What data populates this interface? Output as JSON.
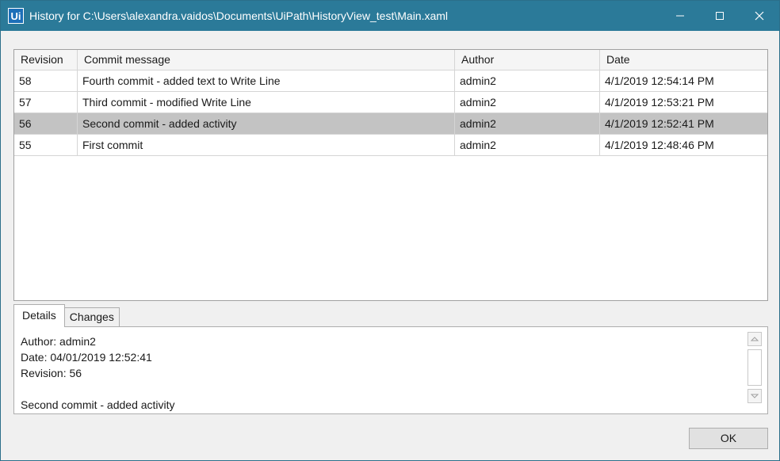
{
  "window": {
    "app_icon_label": "Ui",
    "title": "History for C:\\Users\\alexandra.vaidos\\Documents\\UiPath\\HistoryView_test\\Main.xaml"
  },
  "grid": {
    "headers": {
      "revision": "Revision",
      "message": "Commit message",
      "author": "Author",
      "date": "Date"
    },
    "rows": [
      {
        "revision": "58",
        "message": "Fourth commit - added text to Write Line",
        "author": "admin2",
        "date": "4/1/2019 12:54:14 PM"
      },
      {
        "revision": "57",
        "message": "Third commit - modified Write Line",
        "author": "admin2",
        "date": "4/1/2019 12:53:21 PM"
      },
      {
        "revision": "56",
        "message": "Second commit - added activity",
        "author": "admin2",
        "date": "4/1/2019 12:52:41 PM"
      },
      {
        "revision": "55",
        "message": "First commit",
        "author": "admin2",
        "date": "4/1/2019 12:48:46 PM"
      }
    ],
    "selected_row": 2
  },
  "tabs": {
    "details": "Details",
    "changes": "Changes"
  },
  "details": {
    "author_line": "Author: admin2",
    "date_line": "Date: 04/01/2019 12:52:41",
    "revision_line": "Revision: 56",
    "message_line": "Second commit - added activity"
  },
  "buttons": {
    "ok": "OK"
  },
  "colors": {
    "titlebar": "#2b7a99",
    "selected_row": "#c3c3c3"
  },
  "icons": {
    "minimize": "minimize-icon",
    "maximize": "maximize-icon",
    "close": "close-icon"
  }
}
